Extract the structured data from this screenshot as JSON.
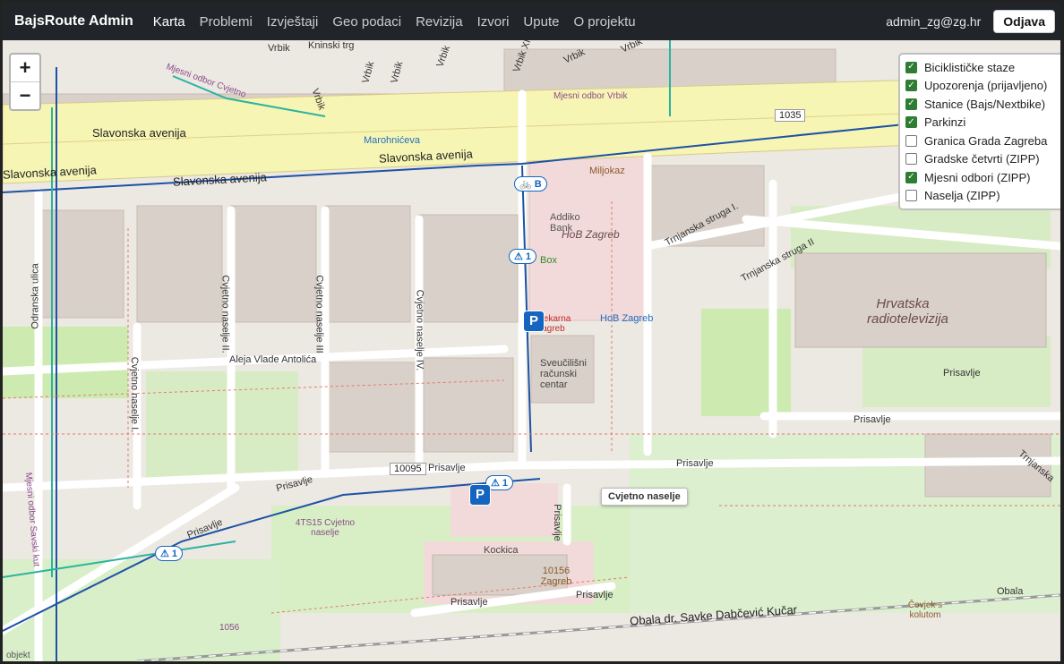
{
  "navbar": {
    "brand": "BajsRoute Admin",
    "links": [
      "Karta",
      "Problemi",
      "Izvještaji",
      "Geo podaci",
      "Revizija",
      "Izvori",
      "Upute",
      "O projektu"
    ],
    "active": "Karta",
    "user": "admin_zg@zg.hr",
    "logout_label": "Odjava"
  },
  "zoom": {
    "in": "+",
    "out": "−"
  },
  "layers": [
    {
      "label": "Biciklističke staze",
      "checked": true
    },
    {
      "label": "Upozorenja (prijavljeno)",
      "checked": true
    },
    {
      "label": "Stanice (Bajs/Nextbike)",
      "checked": true
    },
    {
      "label": "Parkinzi",
      "checked": true
    },
    {
      "label": "Granica Grada Zagreba",
      "checked": false
    },
    {
      "label": "Gradske četvrti (ZIPP)",
      "checked": false
    },
    {
      "label": "Mjesni odbori (ZIPP)",
      "checked": true
    },
    {
      "label": "Naselja (ZIPP)",
      "checked": false
    }
  ],
  "tooltip": "Cvjetno naselje",
  "markers": {
    "warning_1": "⚠ 1",
    "warning_2": "⚠ 1",
    "warning_3": "⚠ 1",
    "station": "B",
    "parking": "P"
  },
  "map_labels": {
    "vrbik1": "Vrbik",
    "kninski": "Kninski trg",
    "vrbik2": "Vrbik",
    "vrbik3": "Vrbik",
    "vrbik4": "Vrbik",
    "vrbik5": "Vrbik XII",
    "vrbik6": "Vrbik",
    "vrbik7": "Vrbik",
    "vrbik8": "Vrbik",
    "mjesni_odbor_vrbik": "Mjesni odbor Vrbik",
    "mjesni_odbor_cvjetno": "Mjesni odbor Cvjetno",
    "slavonska1": "Slavonska avenija",
    "slavonska2": "Slavonska avenija",
    "slavonska3": "Slavonska avenija",
    "slavonska4": "Slavonska avenija",
    "ref_1035": "1035",
    "marohniceva": "Marohnićeva",
    "miljokaz": "Miljokaz",
    "addiko": "Addiko Bank",
    "hob": "HoB Zagreb",
    "hob_box": "Box",
    "hob_zagreb_car": "HoB Zagreb",
    "hrt": "Hrvatska radiotelevizija",
    "trnjanska1": "Trnjanska struga I.",
    "trnjanska2": "Trnjanska struga II",
    "odranska": "Odranska ulica",
    "cvjetno_ii": "Cvjetno naselje II.",
    "cvjetno_iii": "Cvjetno naselje III",
    "cvjetno_iv": "Cvjetno naselje IV.",
    "cvjetno_i": "Cvjetno naselje I.",
    "aleja": "Aleja Vlade Antolića",
    "ljekarna": "Ljekarna Zagreb",
    "sveucilisni": "Sveučilišni računski centar",
    "prisavlje1": "Prisavlje",
    "prisavlje2": "Prisavlje",
    "prisavlje3": "Prisavlje",
    "prisavlje4": "Prisavlje",
    "prisavlje5": "Prisavlje",
    "prisavlje6": "Prisavlje",
    "prisavlje7": "Prisavlje",
    "prisavlje8": "Prisavlje",
    "prisavlje9": "Prisavlje",
    "ref_10095": "10095",
    "cvjetno_naselje_4ts15": "4TS15 Cvjetno naselje",
    "kockica": "Kockica",
    "post": "10156 Zagreb",
    "obala": "Obala dr. Savke Dabčević Kučar",
    "obala2": "Obala",
    "covjek": "Čovjek s kolutom",
    "trnjanska3": "Trnjanska",
    "ms_savski": "Mjesni odbor Savski kut",
    "ref_1056": "1056",
    "objekt": "objekt"
  }
}
